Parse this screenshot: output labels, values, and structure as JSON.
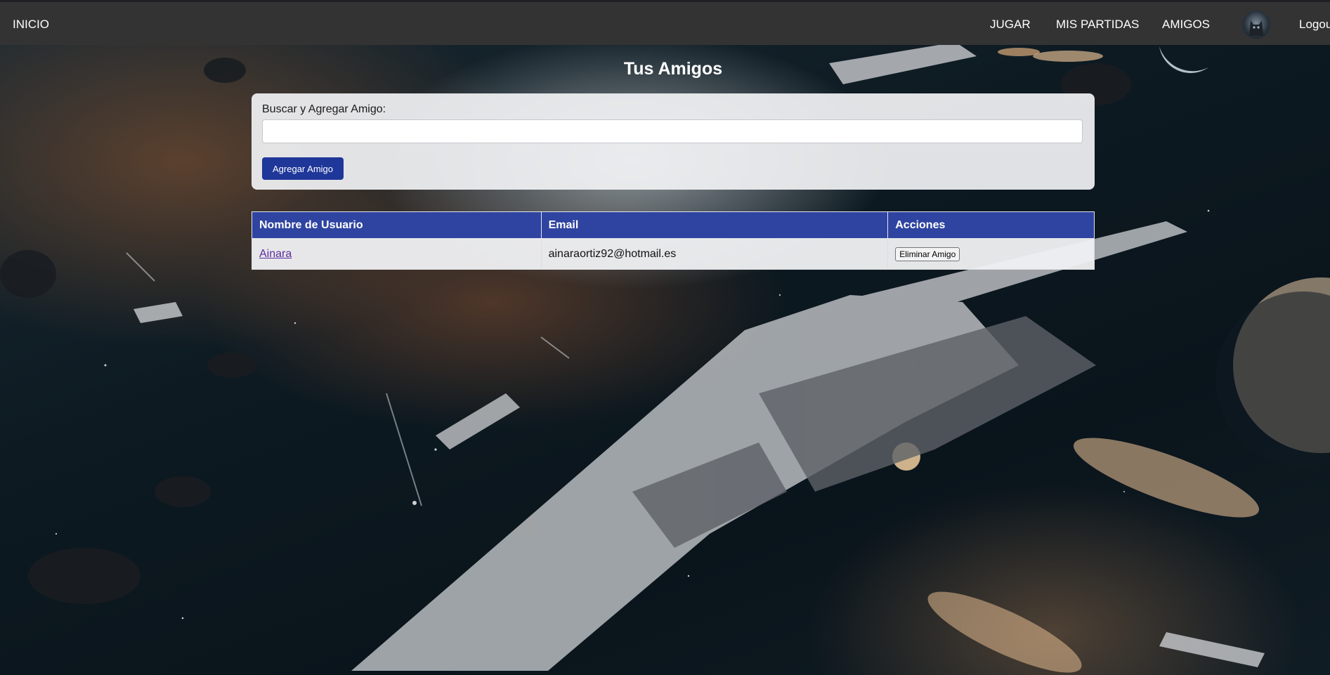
{
  "nav": {
    "home_label": "INICIO",
    "play_label": "JUGAR",
    "my_games_label": "MIS PARTIDAS",
    "friends_label": "AMIGOS",
    "logout_label": "Logou"
  },
  "page": {
    "title": "Tus Amigos"
  },
  "add_friend": {
    "label": "Buscar y Agregar Amigo:",
    "input_value": "",
    "placeholder": "",
    "button_label": "Agregar Amigo"
  },
  "friends_table": {
    "columns": [
      "Nombre de Usuario",
      "Email",
      "Acciones"
    ],
    "rows": [
      {
        "username": "Ainara",
        "email": "ainaraortiz92@hotmail.es",
        "action_label": "Eliminar Amigo"
      }
    ]
  },
  "colors": {
    "topbar": "#333333",
    "table_header": "#2f44a0",
    "primary_button": "#1e3799",
    "link": "#5b2d9e"
  },
  "icons": {
    "avatar": "cat-avatar-icon"
  }
}
